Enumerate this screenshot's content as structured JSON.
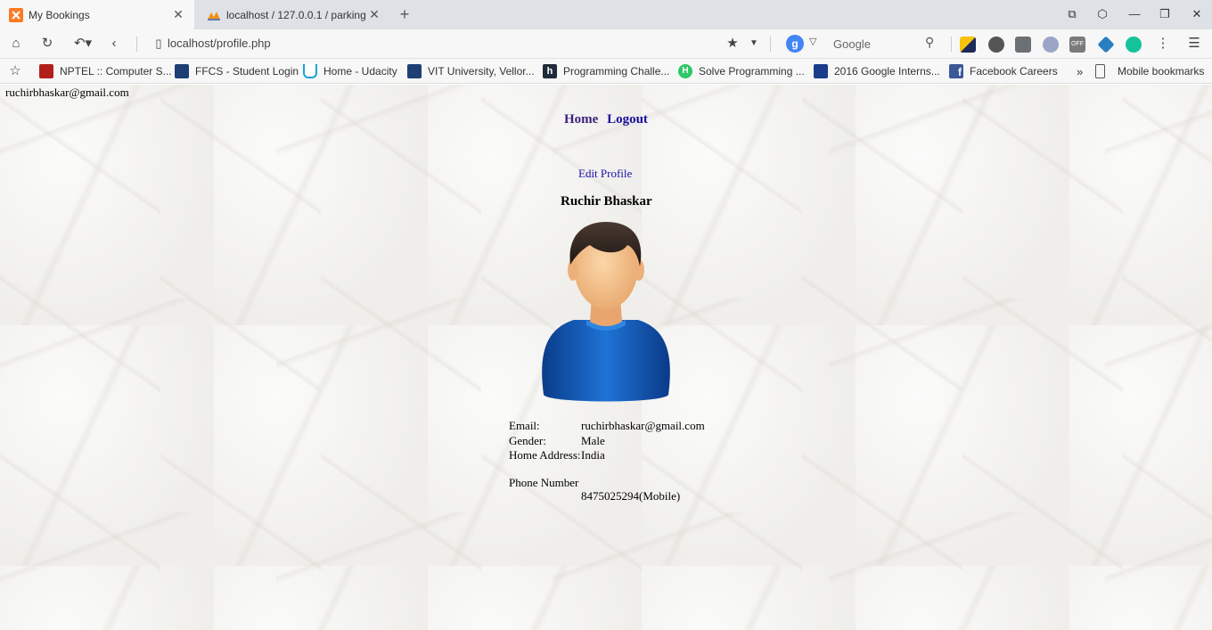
{
  "tabs": [
    {
      "title": "My Bookings",
      "active": true,
      "icon": "xampp-icon"
    },
    {
      "title": "localhost / 127.0.0.1 / parking |",
      "active": false,
      "icon": "phpmyadmin-icon"
    }
  ],
  "address_bar": {
    "url": "localhost/profile.php",
    "search_engine": "Google"
  },
  "bookmarks": [
    {
      "label": "NPTEL :: Computer S...",
      "icon": "nptel-icon",
      "color": "#b3201b"
    },
    {
      "label": "FFCS - Student Login",
      "icon": "vit-icon",
      "color": "#1e3f73"
    },
    {
      "label": "Home - Udacity",
      "icon": "udacity-icon",
      "color": "#1aa3d6"
    },
    {
      "label": "VIT University, Vellor...",
      "icon": "vit-icon",
      "color": "#1e3f73"
    },
    {
      "label": "Programming Challe...",
      "icon": "hackerrank-icon",
      "color": "#1f2b3a"
    },
    {
      "label": "Solve Programming ...",
      "icon": "hackerrank-green-icon",
      "color": "#2ec866"
    },
    {
      "label": "2016 Google Interns...",
      "icon": "bookmark-blue-icon",
      "color": "#1c3c8c"
    },
    {
      "label": "Facebook Careers",
      "icon": "facebook-icon",
      "color": "#3b5998"
    }
  ],
  "bookmarks_overflow": "»",
  "mobile_bookmarks": "Mobile bookmarks",
  "page": {
    "user_email": "ruchirbhaskar@gmail.com",
    "nav": {
      "home": "Home",
      "logout": "Logout"
    },
    "edit_profile": "Edit Profile",
    "name": "Ruchir Bhaskar",
    "details": [
      {
        "label": "Email:",
        "value": "ruchirbhaskar@gmail.com"
      },
      {
        "label": "Gender:",
        "value": "Male"
      },
      {
        "label": "Home Address:",
        "value": "India"
      }
    ],
    "phone_label": "Phone Number",
    "phone_value": "8475025294(Mobile)"
  }
}
